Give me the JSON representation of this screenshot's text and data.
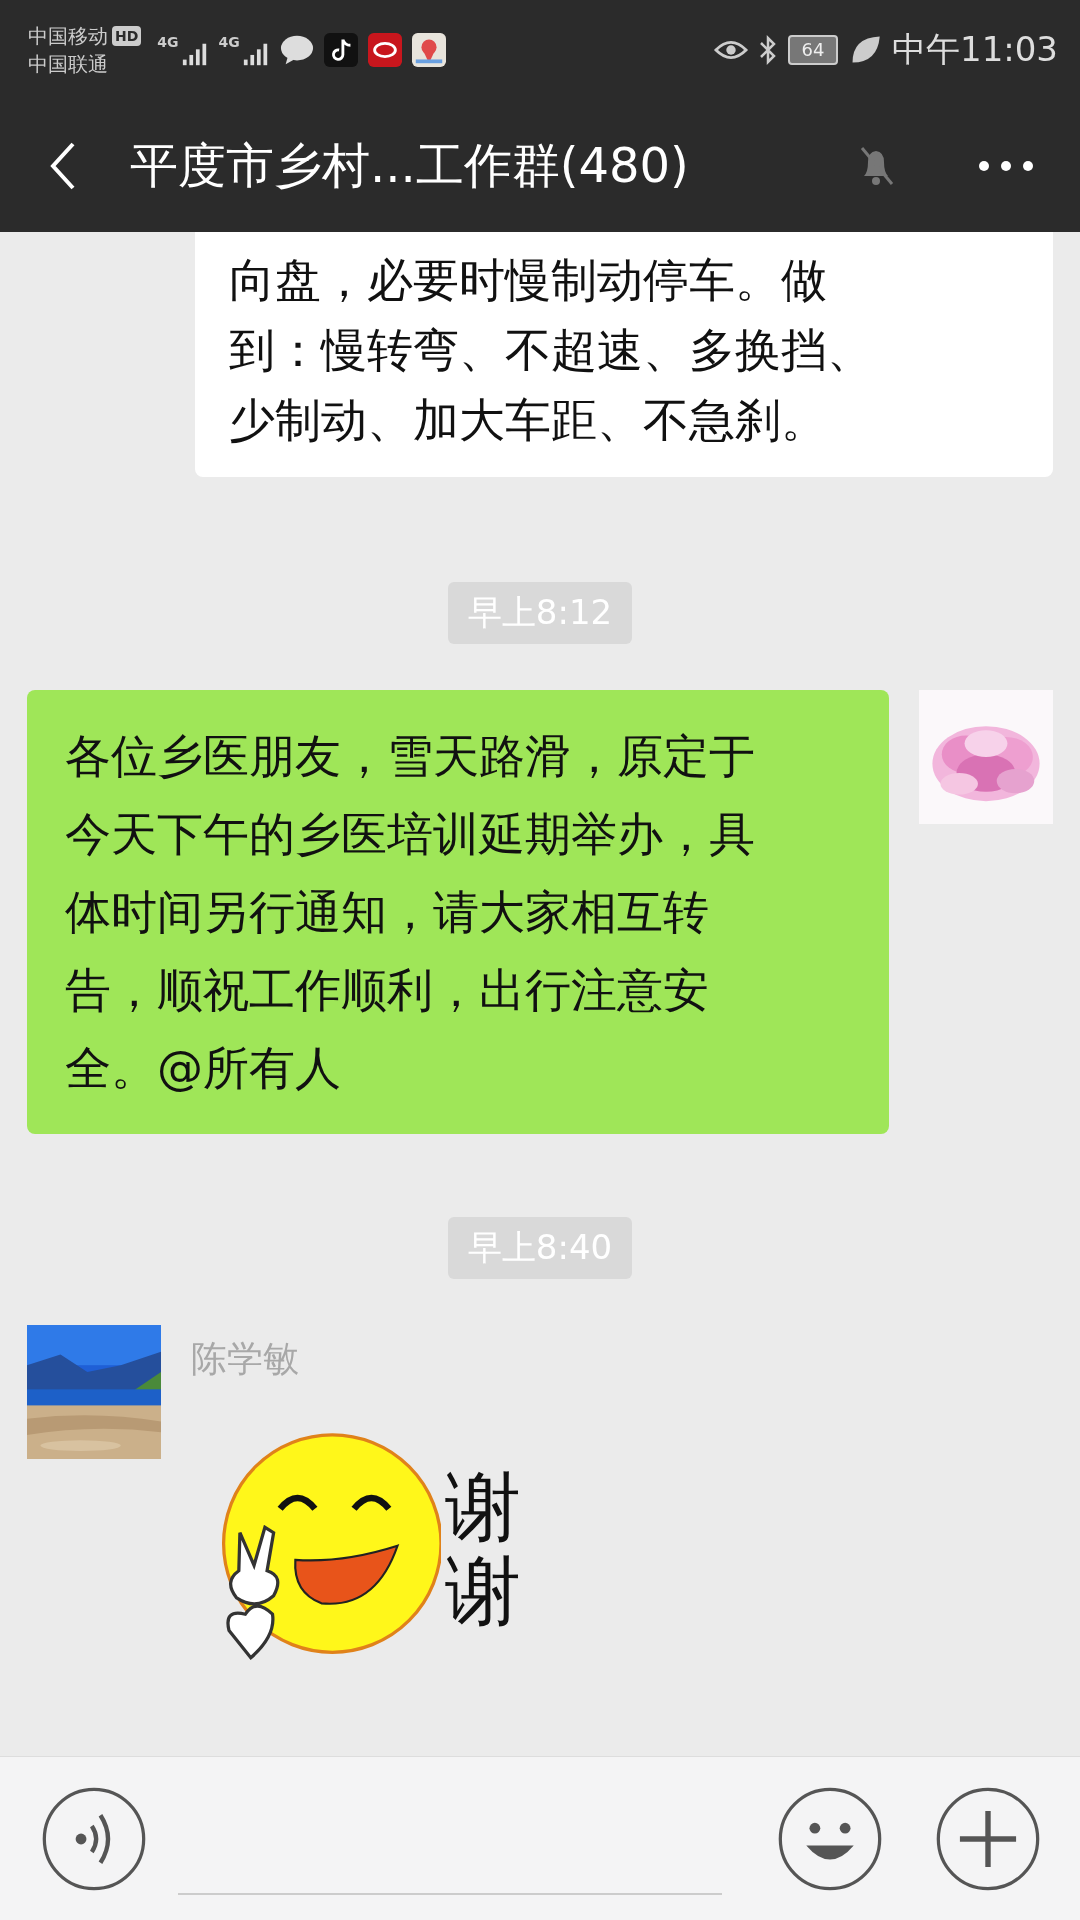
{
  "status_bar": {
    "carrier_1": "中国移动",
    "hd_badge": "HD",
    "carrier_2": "中国联通",
    "network_1": "4G",
    "network_2": "4G",
    "battery": "64",
    "time": "中午11:03"
  },
  "header": {
    "title": "平度市乡村...工作群(480)",
    "muted": true
  },
  "messages": [
    {
      "kind": "received_text",
      "lines": [
        "向盘，必要时慢制动停车。做",
        "到：慢转弯、不超速、多换挡、",
        "少制动、加大车距、不急刹。"
      ]
    },
    {
      "kind": "time",
      "text": "早上8:12"
    },
    {
      "kind": "sent_text",
      "lines": [
        "各位乡医朋友，雪天路滑，原定于",
        "今天下午的乡医培训延期举办，具",
        "体时间另行通知，请大家相互转",
        "告，顺祝工作顺利，出行注意安",
        "全。@所有人"
      ]
    },
    {
      "kind": "time",
      "text": "早上8:40"
    },
    {
      "kind": "sticker",
      "sender": "陈学敏",
      "caption": "谢谢"
    }
  ]
}
